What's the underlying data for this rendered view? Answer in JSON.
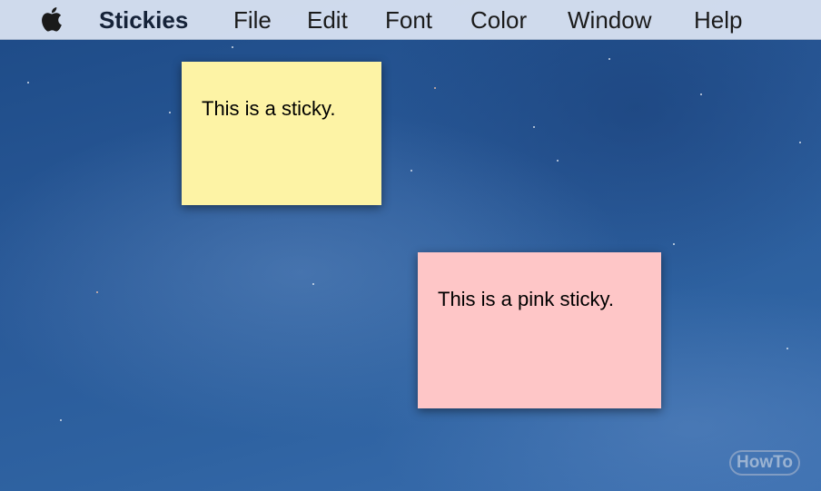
{
  "menubar": {
    "apple_icon": "apple-logo",
    "app_name": "Stickies",
    "items": [
      "File",
      "Edit",
      "Font",
      "Color",
      "Window",
      "Help"
    ]
  },
  "notes": [
    {
      "text": "This is a sticky.",
      "color": "#fdf3a5"
    },
    {
      "text": "This is a pink sticky.",
      "color": "#fec6c7"
    }
  ],
  "watermark": "HowTo",
  "colors": {
    "menubar": "#d6e0f0",
    "desktop": "#22508c"
  }
}
